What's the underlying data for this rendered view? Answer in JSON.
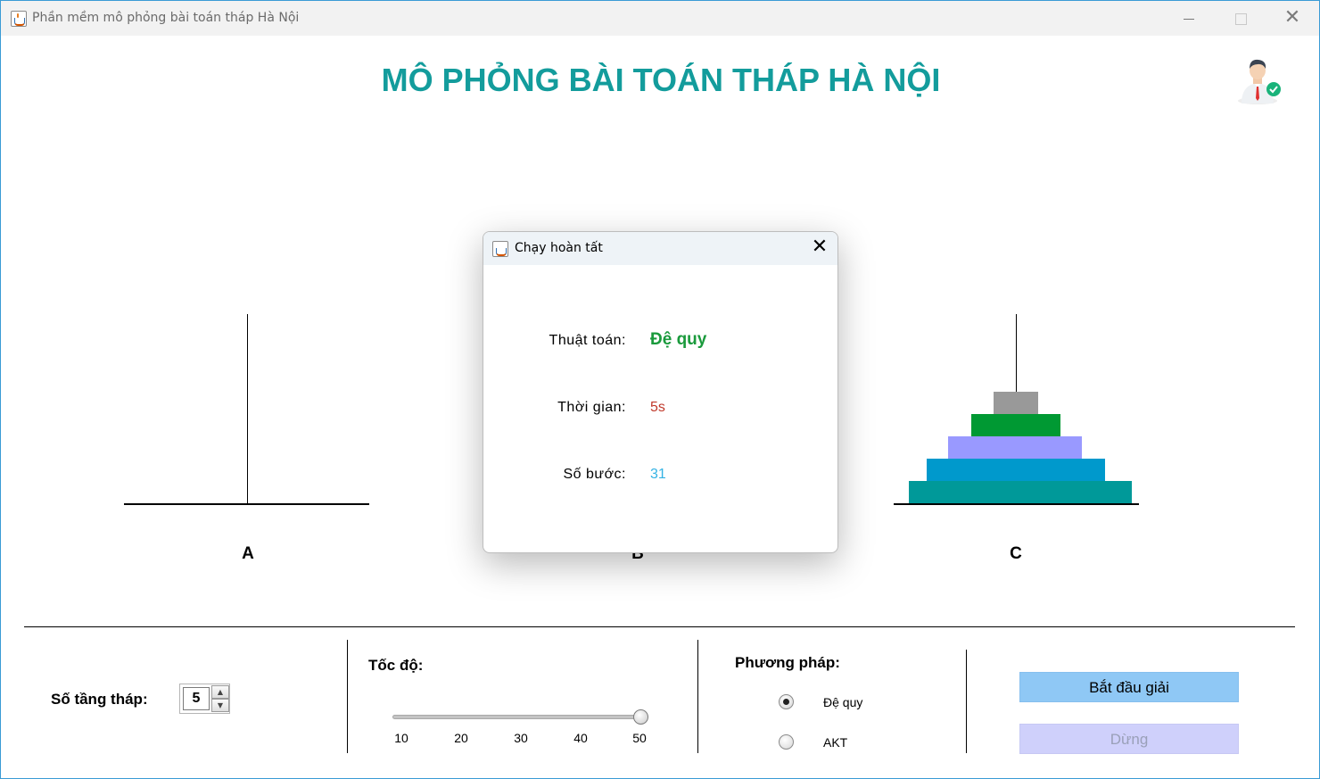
{
  "window": {
    "title": "Phần mềm mô phỏng bài toán tháp Hà Nội",
    "controls": {
      "minimize": "—",
      "maximize": "☐",
      "close": "✕"
    }
  },
  "header": {
    "title": "MÔ PHỎNG BÀI TOÁN THÁP HÀ NỘI",
    "avatar_icon": "user-avatar-icon"
  },
  "pegs": [
    {
      "label": "A",
      "disks": []
    },
    {
      "label": "B",
      "disks": []
    },
    {
      "label": "C",
      "disks": [
        {
          "color": "#009999"
        },
        {
          "color": "#0099cc"
        },
        {
          "color": "#9999ff"
        },
        {
          "color": "#009933"
        },
        {
          "color": "#999999"
        }
      ]
    }
  ],
  "controls": {
    "tower_count_label": "Số tầng tháp:",
    "tower_count_value": "5",
    "speed_label": "Tốc độ:",
    "speed_value": 50,
    "speed_ticks": [
      "10",
      "20",
      "30",
      "40",
      "50"
    ],
    "method_label": "Phương pháp:",
    "methods": [
      {
        "label": "Đệ quy",
        "checked": true
      },
      {
        "label": "AKT",
        "checked": false
      }
    ],
    "start_button": "Bắt đầu giải",
    "stop_button": "Dừng"
  },
  "dialog": {
    "title": "Chạy hoàn tất",
    "close": "✕",
    "algorithm_label": "Thuật toán:",
    "algorithm_value": "Đệ quy",
    "time_label": "Thời gian:",
    "time_value": "5s",
    "steps_label": "Số bước:",
    "steps_value": "31"
  },
  "colors": {
    "title": "#139c9c",
    "start_button": "#8fc8f5",
    "stop_button": "#cfd0fb"
  }
}
